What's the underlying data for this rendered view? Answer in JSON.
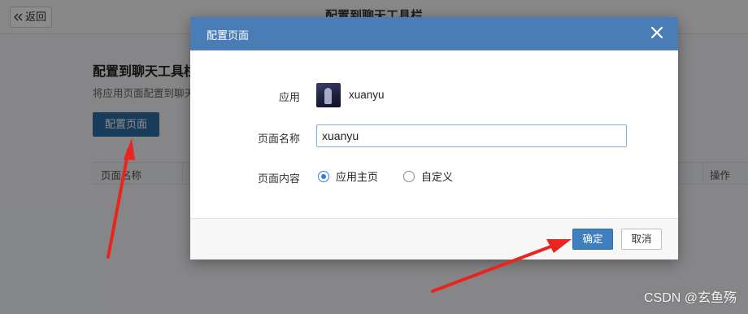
{
  "page": {
    "back_label": "返回",
    "title": "配置到聊天工具栏",
    "section_title": "配置到聊天工具栏",
    "section_desc": "将应用页面配置到聊天",
    "config_button": "配置页面",
    "table_headers": {
      "name": "页面名称",
      "action": "操作"
    }
  },
  "modal": {
    "title": "配置页面",
    "app_label": "应用",
    "app_name": "xuanyu",
    "page_name_label": "页面名称",
    "page_name_value": "xuanyu",
    "content_label": "页面内容",
    "options": [
      {
        "label": "应用主页",
        "selected": true
      },
      {
        "label": "自定义",
        "selected": false
      }
    ],
    "ok_label": "确定",
    "cancel_label": "取消"
  },
  "watermark": "CSDN @玄鱼殇",
  "colors": {
    "header": "#4a7db5",
    "primary_button": "#3f7fbf",
    "config_button": "#2d6ea4",
    "annotation_arrow": "#e8261f"
  },
  "icons": {
    "back": "double-chevron-left-icon",
    "close": "close-icon"
  }
}
